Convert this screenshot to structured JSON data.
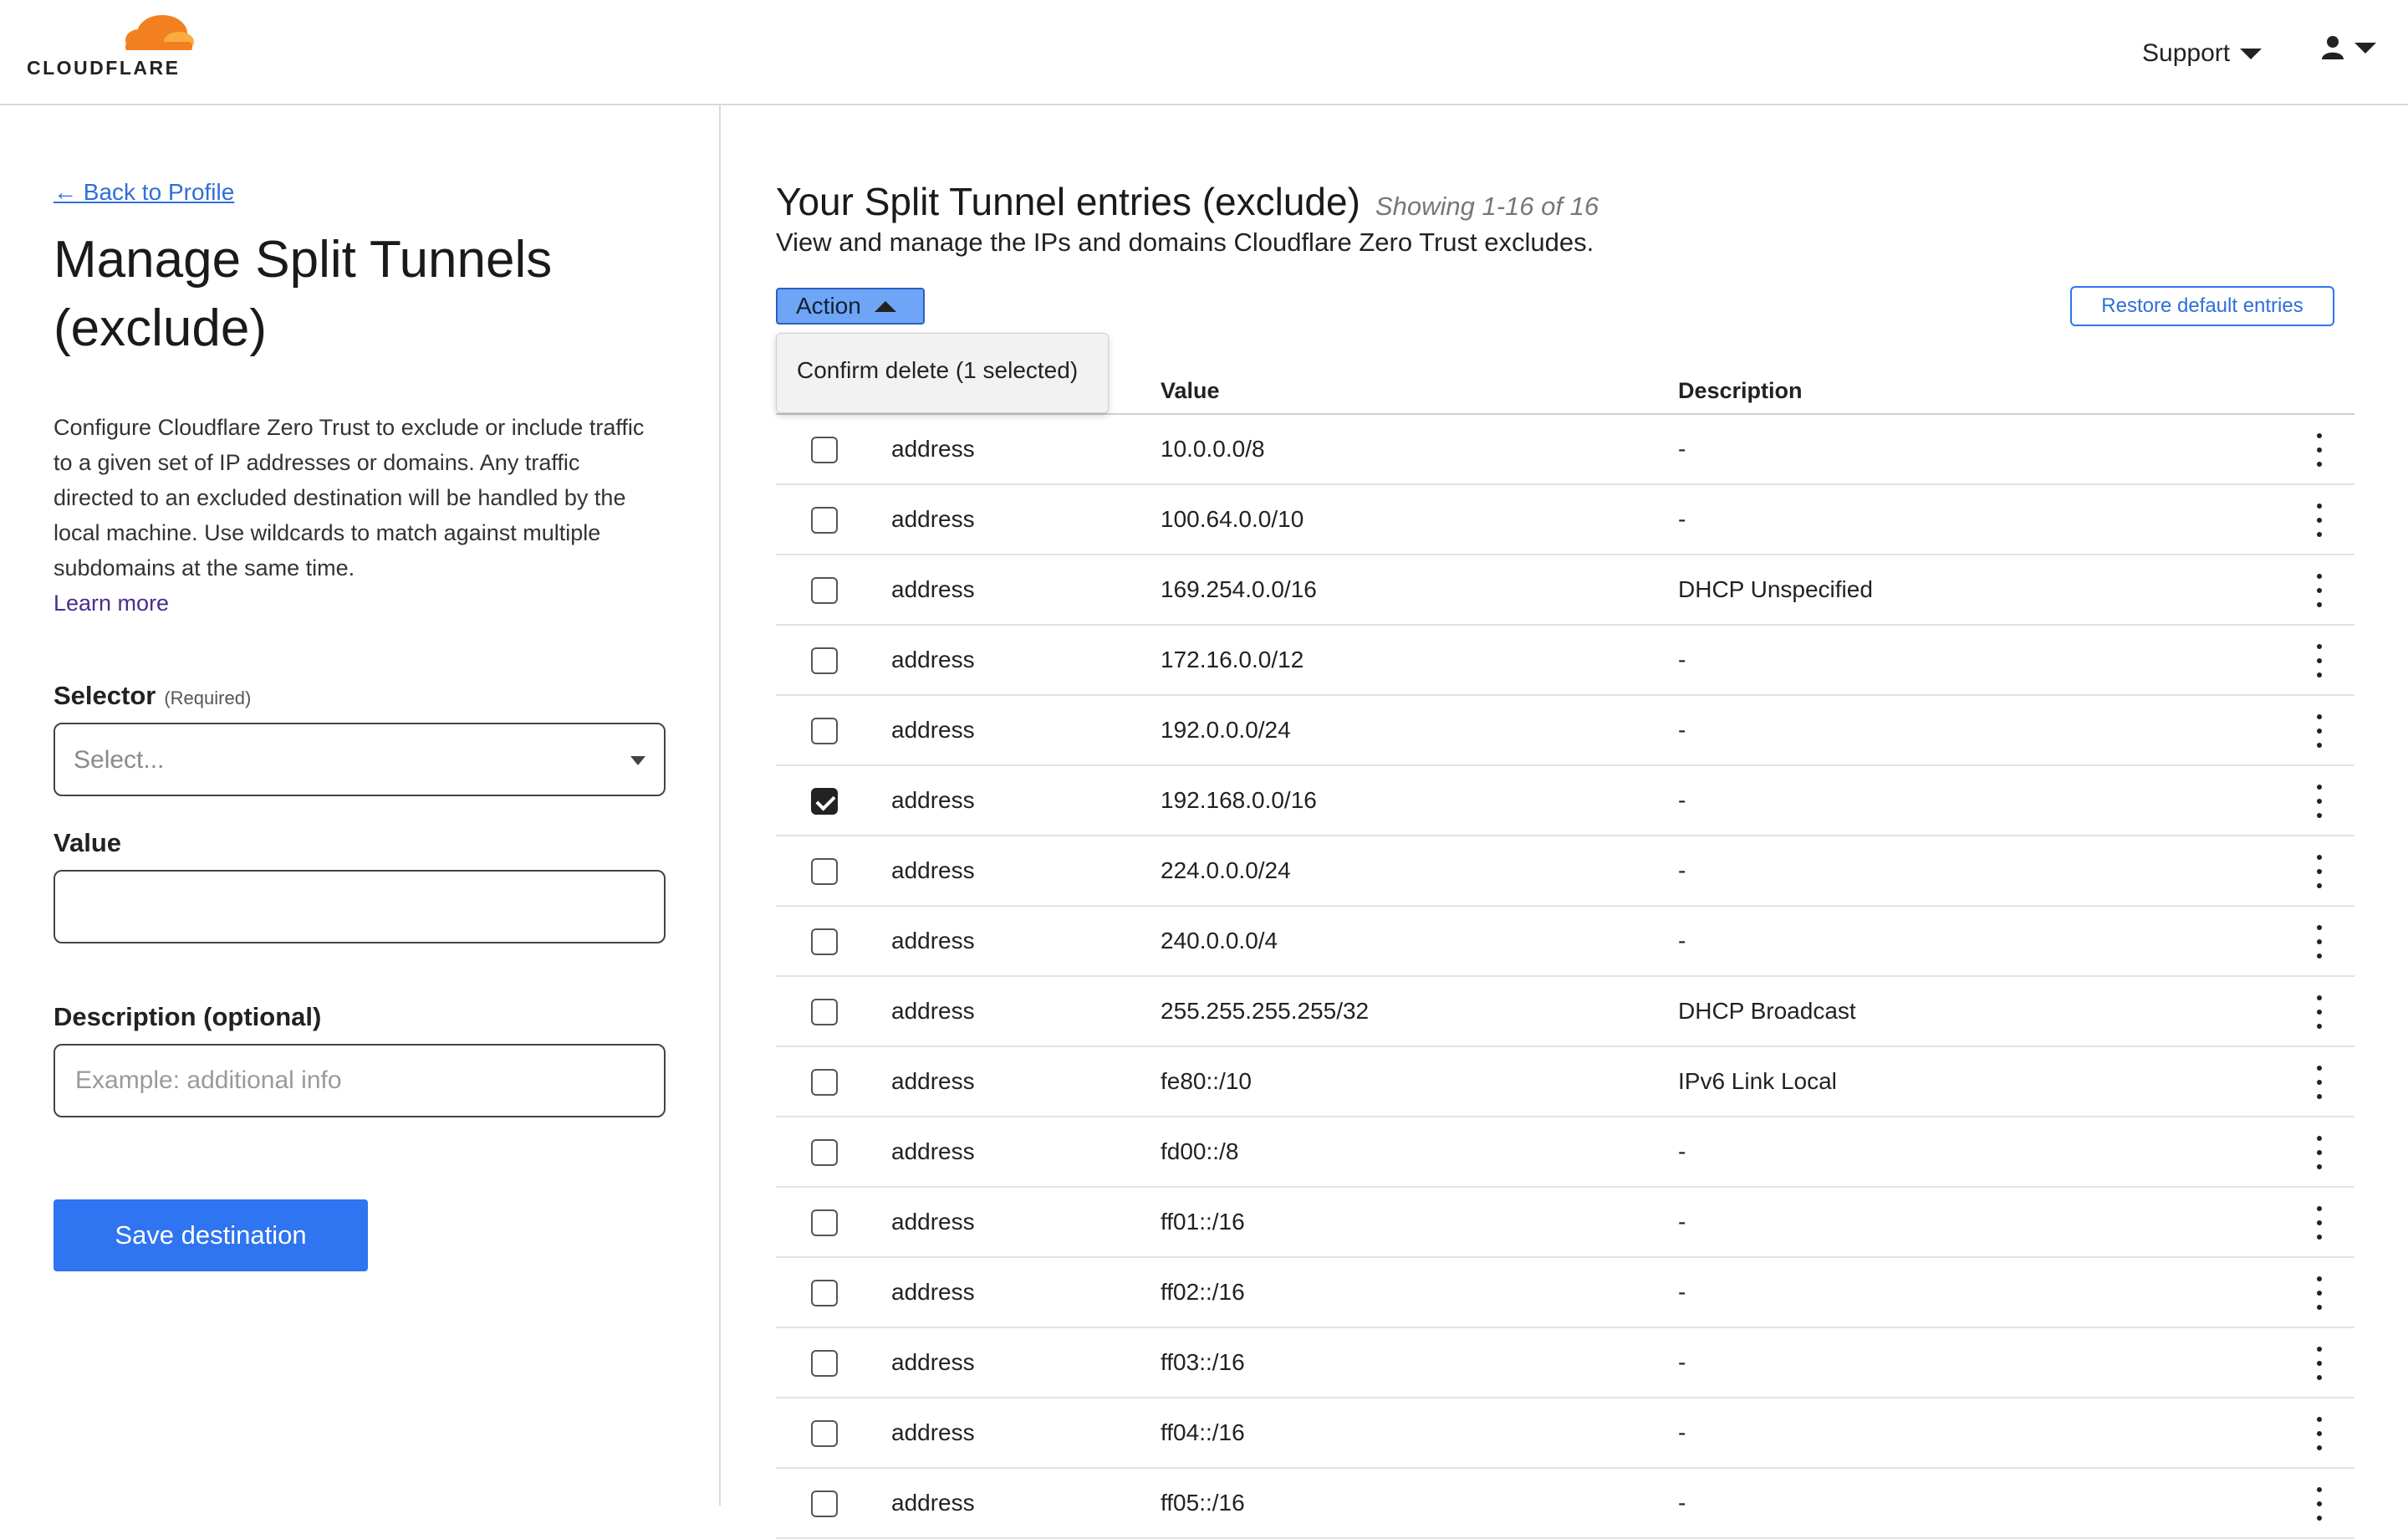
{
  "header": {
    "logo_text": "CLOUDFLARE",
    "support_label": "Support",
    "icons": {
      "user": "user-icon",
      "caret": "caret-down-icon"
    }
  },
  "left": {
    "back_link": "← Back to Profile",
    "title": "Manage Split Tunnels (exclude)",
    "description": "Configure Cloudflare Zero Trust to exclude or include traffic to a given set of IP addresses or domains. Any traffic directed to an excluded destination will be handled by the local machine. Use wildcards to match against multiple subdomains at the same time.",
    "learn_more": "Learn more",
    "selector_label": "Selector",
    "selector_required": "(Required)",
    "selector_placeholder": "Select...",
    "value_label": "Value",
    "value_input": "",
    "description_label": "Description (optional)",
    "description_placeholder": "Example: additional info",
    "save_button": "Save destination"
  },
  "main": {
    "title": "Your Split Tunnel entries (exclude)",
    "showing": "Showing 1-16 of 16",
    "subtitle": "View and manage the IPs and domains Cloudflare Zero Trust excludes.",
    "action_button": "Action",
    "restore_button": "Restore default entries",
    "dropdown_item": "Confirm delete (1 selected)",
    "columns": {
      "value": "Value",
      "description": "Description"
    },
    "rows": [
      {
        "type": "address",
        "value": "10.0.0.0/8",
        "description": "-",
        "checked": false
      },
      {
        "type": "address",
        "value": "100.64.0.0/10",
        "description": "-",
        "checked": false
      },
      {
        "type": "address",
        "value": "169.254.0.0/16",
        "description": "DHCP Unspecified",
        "checked": false
      },
      {
        "type": "address",
        "value": "172.16.0.0/12",
        "description": "-",
        "checked": false
      },
      {
        "type": "address",
        "value": "192.0.0.0/24",
        "description": "-",
        "checked": false
      },
      {
        "type": "address",
        "value": "192.168.0.0/16",
        "description": "-",
        "checked": true
      },
      {
        "type": "address",
        "value": "224.0.0.0/24",
        "description": "-",
        "checked": false
      },
      {
        "type": "address",
        "value": "240.0.0.0/4",
        "description": "-",
        "checked": false
      },
      {
        "type": "address",
        "value": "255.255.255.255/32",
        "description": "DHCP Broadcast",
        "checked": false
      },
      {
        "type": "address",
        "value": "fe80::/10",
        "description": "IPv6 Link Local",
        "checked": false
      },
      {
        "type": "address",
        "value": "fd00::/8",
        "description": "-",
        "checked": false
      },
      {
        "type": "address",
        "value": "ff01::/16",
        "description": "-",
        "checked": false
      },
      {
        "type": "address",
        "value": "ff02::/16",
        "description": "-",
        "checked": false
      },
      {
        "type": "address",
        "value": "ff03::/16",
        "description": "-",
        "checked": false
      },
      {
        "type": "address",
        "value": "ff04::/16",
        "description": "-",
        "checked": false
      },
      {
        "type": "address",
        "value": "ff05::/16",
        "description": "-",
        "checked": false
      }
    ]
  },
  "colors": {
    "accent": "#2f74f0",
    "link": "#2f6fd6",
    "brand_orange": "#f38020",
    "action_bg": "#6ea5f7"
  }
}
